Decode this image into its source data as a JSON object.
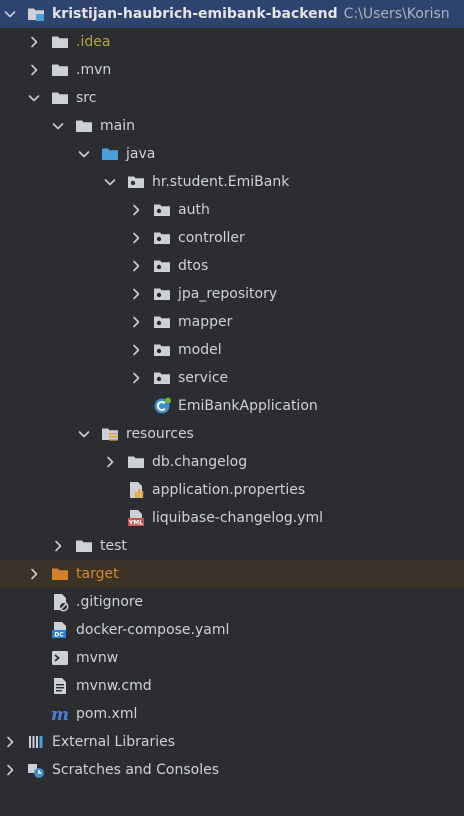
{
  "colors": {
    "background": "#2b2d30",
    "selection": "#2e436e",
    "folder": "#cdd0d4",
    "source_folder": "#4e9fd6",
    "excluded_folder": "#d2802a",
    "idea_label": "#b7a347"
  },
  "tree": {
    "root": {
      "label": "kristijan-haubrich-emibank-backend",
      "path": "C:\\Users\\Korisn",
      "icon": "module-folder-icon"
    },
    "items": [
      {
        "label": ".idea",
        "icon": "folder-icon",
        "expanded": false
      },
      {
        "label": ".mvn",
        "icon": "folder-icon",
        "expanded": false
      },
      {
        "label": "src",
        "icon": "folder-icon",
        "expanded": true
      },
      {
        "label": "main",
        "icon": "folder-icon",
        "expanded": true
      },
      {
        "label": "java",
        "icon": "source-folder-icon",
        "expanded": true
      },
      {
        "label": "hr.student.EmiBank",
        "icon": "package-icon",
        "expanded": true
      },
      {
        "label": "auth",
        "icon": "package-icon",
        "expanded": false
      },
      {
        "label": "controller",
        "icon": "package-icon",
        "expanded": false
      },
      {
        "label": "dtos",
        "icon": "package-icon",
        "expanded": false
      },
      {
        "label": "jpa_repository",
        "icon": "package-icon",
        "expanded": false
      },
      {
        "label": "mapper",
        "icon": "package-icon",
        "expanded": false
      },
      {
        "label": "model",
        "icon": "package-icon",
        "expanded": false
      },
      {
        "label": "service",
        "icon": "package-icon",
        "expanded": false
      },
      {
        "label": "EmiBankApplication",
        "icon": "spring-class-icon"
      },
      {
        "label": "resources",
        "icon": "resources-folder-icon",
        "expanded": true
      },
      {
        "label": "db.changelog",
        "icon": "folder-icon",
        "expanded": false
      },
      {
        "label": "application.properties",
        "icon": "properties-file-icon"
      },
      {
        "label": "liquibase-changelog.yml",
        "icon": "yaml-file-icon"
      },
      {
        "label": "test",
        "icon": "folder-icon",
        "expanded": false
      },
      {
        "label": "target",
        "icon": "excluded-folder-icon",
        "expanded": false
      },
      {
        "label": ".gitignore",
        "icon": "gitignore-file-icon"
      },
      {
        "label": "docker-compose.yaml",
        "icon": "docker-compose-file-icon"
      },
      {
        "label": "mvnw",
        "icon": "shell-script-icon"
      },
      {
        "label": "mvnw.cmd",
        "icon": "text-file-icon"
      },
      {
        "label": "pom.xml",
        "icon": "maven-pom-icon"
      },
      {
        "label": "External Libraries",
        "icon": "libraries-icon",
        "expanded": false
      },
      {
        "label": "Scratches and Consoles",
        "icon": "scratches-icon",
        "expanded": false
      }
    ]
  }
}
